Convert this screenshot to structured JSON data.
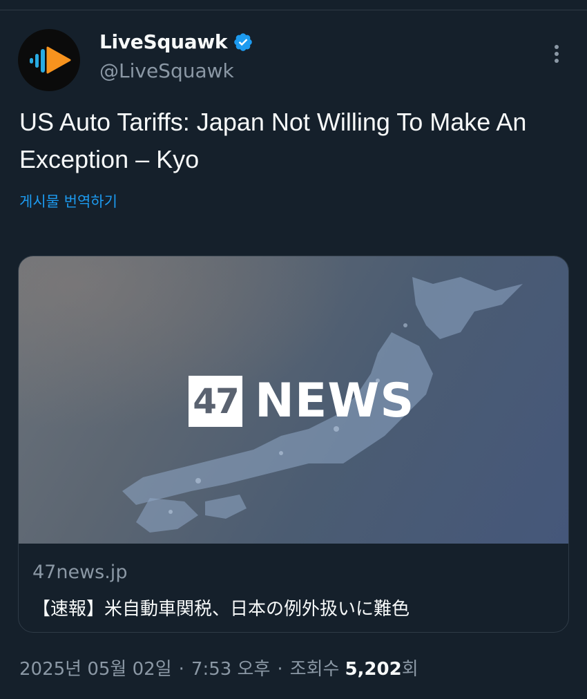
{
  "post": {
    "author": {
      "name": "LiveSquawk",
      "handle": "@LiveSquawk",
      "verified": true,
      "avatar_icon": "livesquawk-logo-icon"
    },
    "more_icon": "more-options-icon",
    "text": "US Auto Tariffs: Japan Not Willing To Make An Exception – Kyo",
    "translate_label": "게시물 번역하기",
    "card": {
      "image_logo_number": "47",
      "image_logo_text": "NEWS",
      "domain": "47news.jp",
      "title": "【速報】米自動車関税、日本の例外扱いに難色"
    },
    "meta": {
      "date": "2025년 05월 02일",
      "time": "7:53 오후",
      "views_label": "조회수",
      "views_count": "5,202",
      "views_suffix": "회"
    }
  },
  "colors": {
    "background": "#15202b",
    "text_primary": "#f7f9f9",
    "text_secondary": "#8b98a5",
    "link": "#1d9bf0",
    "verified_badge": "#1d9bf0",
    "brand_orange": "#f7931e",
    "brand_blue": "#29abe2"
  }
}
